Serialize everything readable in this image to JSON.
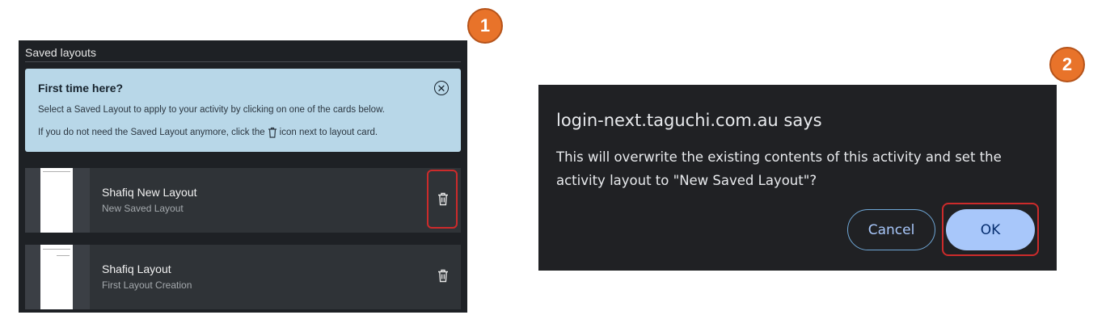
{
  "markers": {
    "step1": "1",
    "step2": "2"
  },
  "saved_layouts": {
    "header": "Saved layouts",
    "info": {
      "title": "First time here?",
      "line1": "Select a Saved Layout to apply to your activity by clicking on one of the cards below.",
      "line2_before": "If you do not need the Saved Layout anymore, click the",
      "line2_after": "icon next to layout card.",
      "close_icon": "close-circle-icon"
    },
    "cards": [
      {
        "title": "Shafiq New Layout",
        "subtitle": "New Saved Layout",
        "action_icon": "trash-icon"
      },
      {
        "title": "Shafiq Layout",
        "subtitle": "First Layout Creation",
        "action_icon": "trash-icon"
      }
    ]
  },
  "dialog": {
    "title": "login-next.taguchi.com.au says",
    "message": "This will overwrite the existing contents of this activity and set the activity layout to \"New Saved Layout\"?",
    "cancel_label": "Cancel",
    "ok_label": "OK"
  },
  "colors": {
    "marker": "#e8732a",
    "highlight": "#cc2b2b",
    "info_bg": "#b8d7e8",
    "ok_button": "#a8c7fa",
    "dialog_bg": "#202124"
  }
}
